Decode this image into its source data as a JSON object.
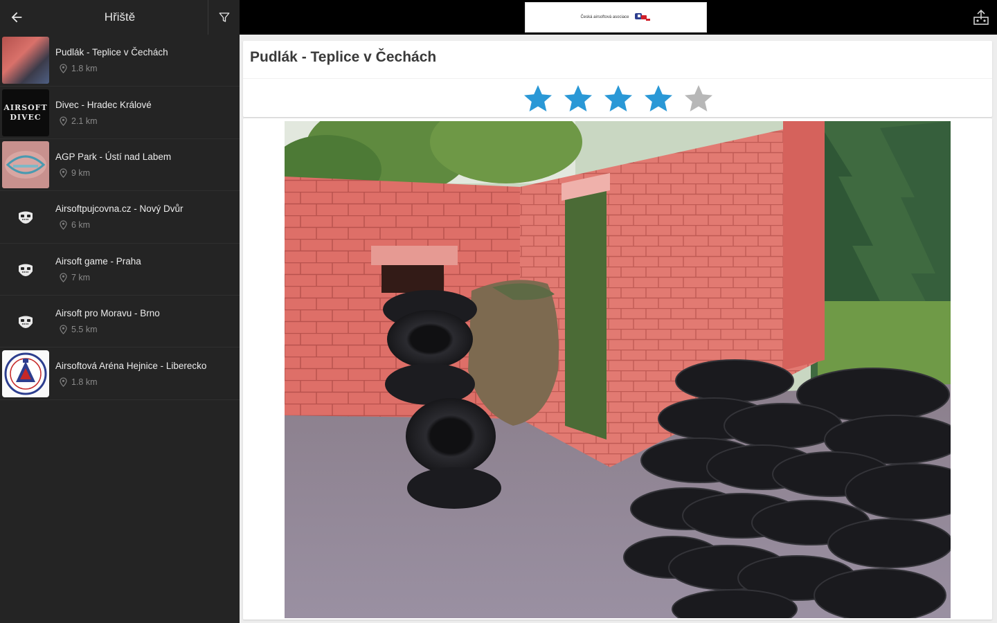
{
  "sidebar": {
    "title": "Hřiště",
    "items": [
      {
        "name": "Pudlák - Teplice v Čechách",
        "distance": "1.8 km",
        "thumb": "photo"
      },
      {
        "name": "Divec - Hradec Králové",
        "distance": "2.1 km",
        "thumb": "divec"
      },
      {
        "name": "AGP Park - Ústí nad Labem",
        "distance": "9 km",
        "thumb": "agp"
      },
      {
        "name": "Airsoftpujcovna.cz - Nový Dvůr",
        "distance": "6 km",
        "thumb": "placeholder"
      },
      {
        "name": "Airsoft game - Praha",
        "distance": "7 km",
        "thumb": "placeholder"
      },
      {
        "name": "Airsoft pro Moravu - Brno",
        "distance": "5.5 km",
        "thumb": "placeholder"
      },
      {
        "name": "Airsoftová Aréna Hejnice - Liberecko",
        "distance": "1.8 km",
        "thumb": "arena"
      }
    ],
    "divec_thumb_text": [
      "AIRSOFT",
      "DIVEC"
    ],
    "icons": {
      "back": "arrow-left-icon",
      "filter": "filter-icon",
      "location": "location-pin-icon",
      "placeholder": "airsoft-mask-icon"
    }
  },
  "topbar": {
    "ad_text": "Česká airsoftová asociace",
    "icons": {
      "share": "share-icon"
    }
  },
  "detail": {
    "title": "Pudlák - Teplice v Čechách",
    "rating": {
      "value": 4,
      "max": 5
    },
    "photo_description_icon": "field-photo"
  },
  "colors": {
    "sidebar_bg": "#242424",
    "star_filled": "#2a98d6",
    "star_empty": "#b7b7b7",
    "detail_bg": "#ededed"
  }
}
